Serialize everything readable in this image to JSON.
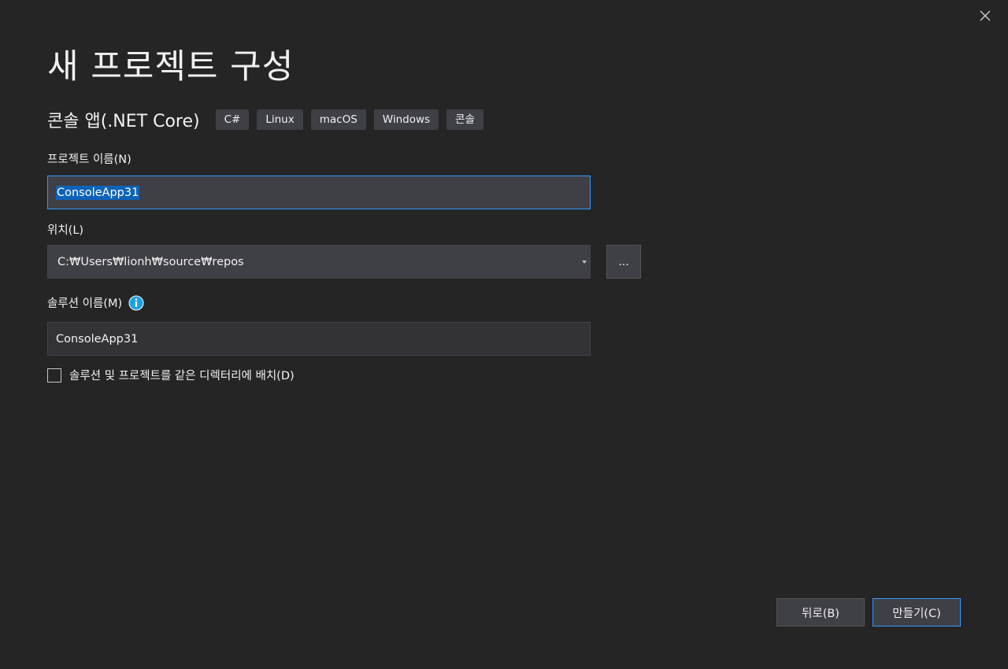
{
  "dialog": {
    "title": "새 프로젝트 구성",
    "close_icon": "close-icon"
  },
  "template": {
    "name": "콘솔 앱(.NET Core)",
    "tags": [
      "C#",
      "Linux",
      "macOS",
      "Windows",
      "콘솔"
    ]
  },
  "project_name": {
    "label": "프로젝트 이름(N)",
    "value": "ConsoleApp31"
  },
  "location": {
    "label": "위치(L)",
    "value": "C:₩Users₩lionh₩source₩repos",
    "browse_label": "..."
  },
  "solution_name": {
    "label": "솔루션 이름(M)",
    "value": "ConsoleApp31",
    "info_icon": "info-icon"
  },
  "same_dir": {
    "label": "솔루션 및 프로젝트를 같은 디렉터리에 배치(D)",
    "checked": false
  },
  "buttons": {
    "back": "뒤로(B)",
    "create": "만들기(C)"
  },
  "colors": {
    "background": "#252526",
    "accent": "#3399ff",
    "selection": "#0e63b9",
    "info": "#1ba1e2"
  }
}
